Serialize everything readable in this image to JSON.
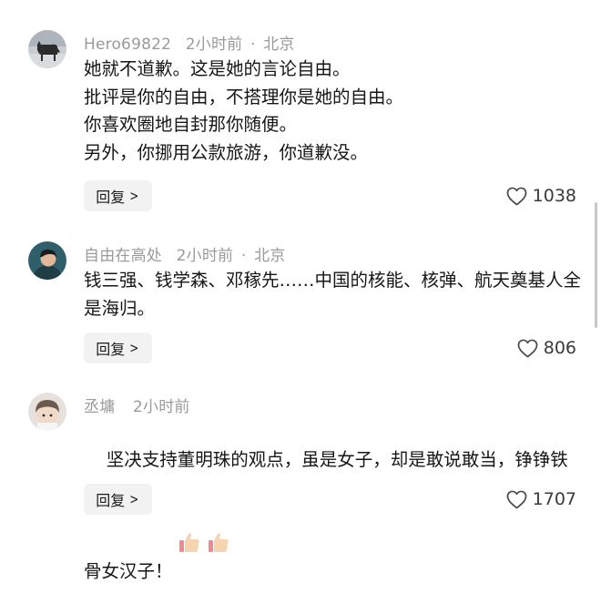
{
  "comments": [
    {
      "username": "Hero69822",
      "time": "2小时前",
      "separator": "·",
      "location": "北京",
      "content": "她就不道歉。这是她的言论自由。\n批评是你的自由，不搭理你是她的自由。\n你喜欢圈地自封那你随便。\n另外，你挪用公款旅游，你道歉没。",
      "reply_label": "回复",
      "likes": "1038"
    },
    {
      "username": "自由在高处",
      "time": "2小时前",
      "separator": "·",
      "location": "北京",
      "content": "钱三强、钱学森、邓稼先……中国的核能、核弹、航天奠基人全是海归。",
      "reply_label": "回复",
      "likes": "806"
    },
    {
      "username": "丞墉",
      "time": "2小时前",
      "content": "坚决支持董明珠的观点，虽是女子，却是敢说敢当，铮铮铁骨女汉子！",
      "reply_label": "回复",
      "likes": "1707"
    }
  ],
  "icons": {
    "like": "heart-outline-icon",
    "reply_chevron": "chevron-right-icon",
    "emoji": "thumbs-up-emoji"
  },
  "colors": {
    "meta": "#9a9a9a",
    "text": "#161616",
    "reply_bg": "#f2f2f2"
  }
}
